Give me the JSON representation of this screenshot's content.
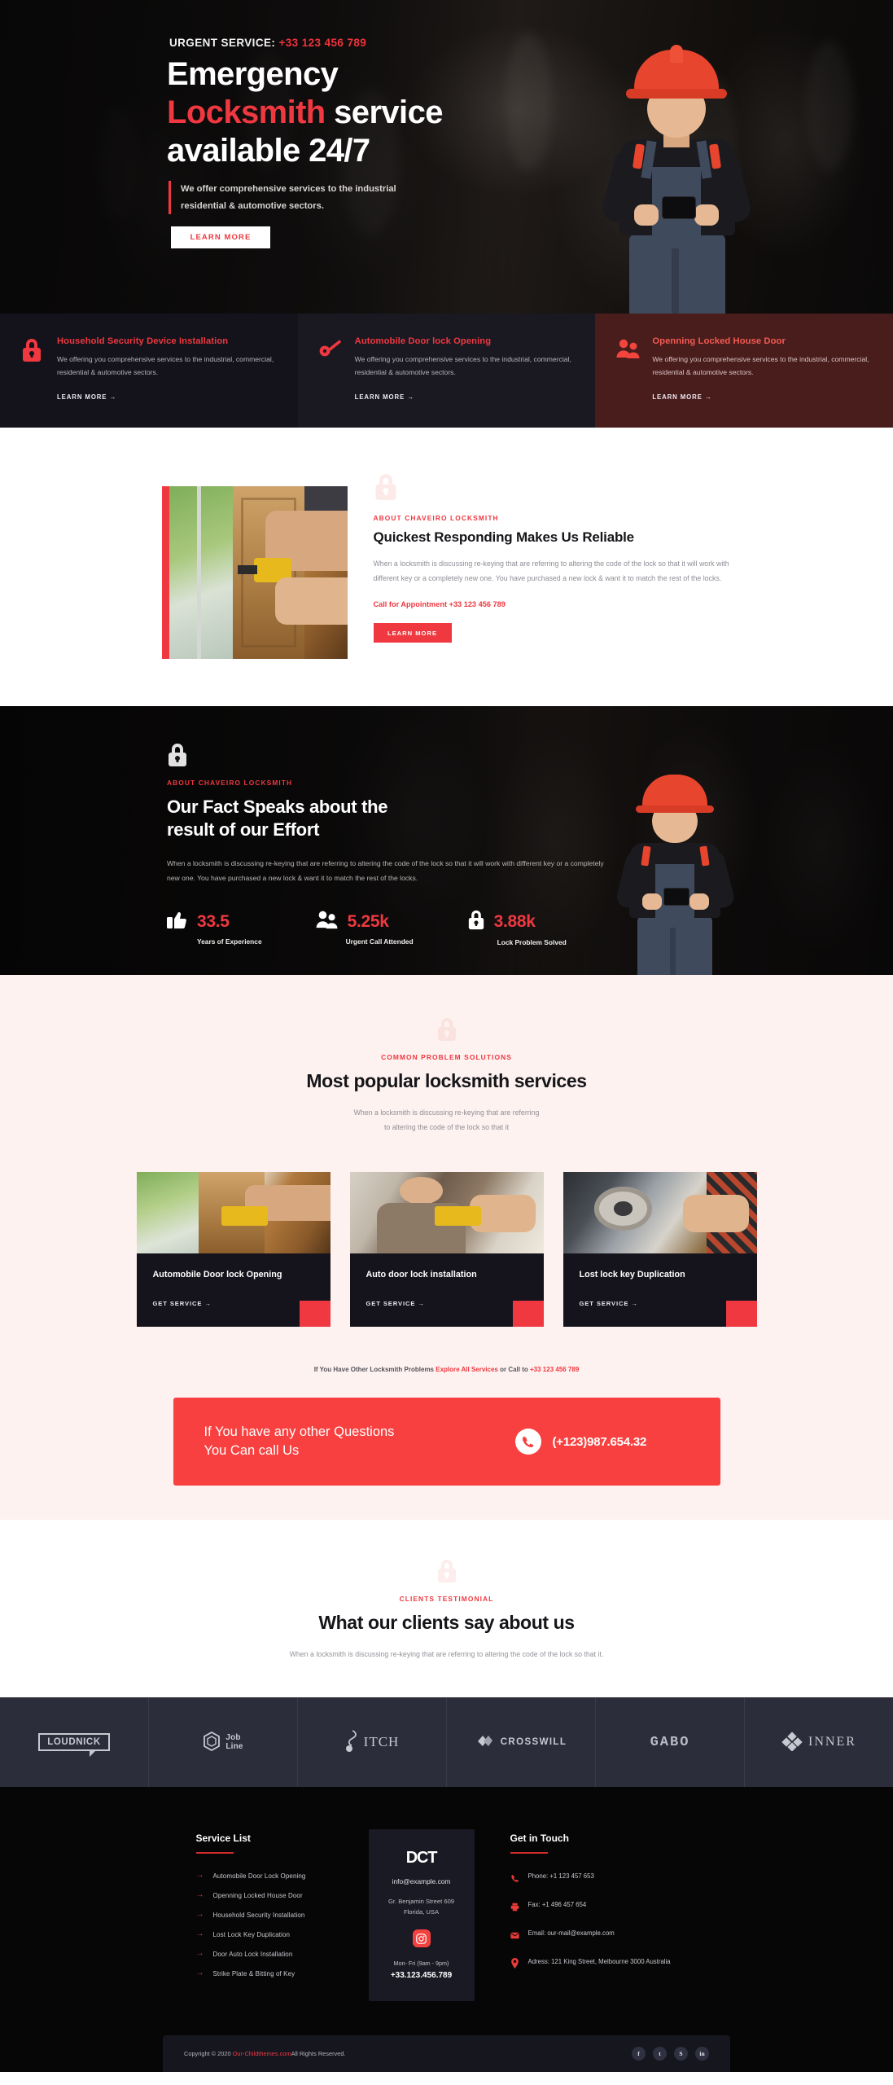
{
  "hero": {
    "urgent_label": "URGENT SERVICE:",
    "urgent_phone": "+33 123 456 789",
    "title_line1": "Emergency",
    "title_red": "Locksmith",
    "title_line2_rest": " service",
    "title_line3": "available 24/7",
    "subtitle": "We offer comprehensive services to the industrial residential & automotive sectors.",
    "button": "LEARN MORE"
  },
  "service_strip": [
    {
      "icon": "padlock-icon",
      "title": "Household Security Device Installation",
      "desc": "We offering you comprehensive services to the industrial, commercial, residential & automotive sectors.",
      "link": "LEARN MORE →"
    },
    {
      "icon": "key-icon",
      "title": "Automobile Door lock Opening",
      "desc": "We offering you comprehensive services to the industrial, commercial, residential & automotive sectors.",
      "link": "LEARN MORE →"
    },
    {
      "icon": "people-icon",
      "title": "Openning Locked House Door",
      "desc": "We offering you comprehensive services to the industrial, commercial, residential & automotive sectors.",
      "link": "LEARN MORE →"
    }
  ],
  "about": {
    "eyebrow": "ABOUT CHAVEIRO LOCKSMITH",
    "heading": "Quickest Responding Makes Us Reliable",
    "paragraph": "When a locksmith is discussing re-keying that are referring to altering the code of the lock so that it will work with different key or a completely new one. You have purchased a new lock & want it to match the rest of the locks.",
    "call_label": "Call for Appointment",
    "call_phone": "+33 123 456 789",
    "button": "LEARN MORE"
  },
  "facts": {
    "eyebrow": "ABOUT CHAVEIRO LOCKSMITH",
    "heading_line1": "Our Fact Speaks about the",
    "heading_line2": "result of our Effort",
    "paragraph": "When a locksmith is discussing re-keying that are referring to altering the code of the lock so that it will work with different key or a completely new one. You have purchased a new lock & want it to match the rest of the locks.",
    "stats": [
      {
        "icon": "thumbs-up-icon",
        "value": "33.5",
        "label": "Years of Experience"
      },
      {
        "icon": "people-icon",
        "value": "5.25k",
        "label": "Urgent Call Attended"
      },
      {
        "icon": "padlock-icon",
        "value": "3.88k",
        "label": "Lock Problem Solved"
      }
    ]
  },
  "popular": {
    "eyebrow": "COMMON PROBLEM SOLUTIONS",
    "heading": "Most popular locksmith services",
    "paragraph_line1": "When a locksmith is discussing re-keying that are referring",
    "paragraph_line2": "to altering the code of the lock so that it",
    "cards": [
      {
        "title": "Automobile Door lock Opening",
        "link": "GET SERVICE →"
      },
      {
        "title": "Auto door lock installation",
        "link": "GET SERVICE →"
      },
      {
        "title": "Lost lock key Duplication",
        "link": "GET SERVICE →"
      }
    ],
    "explore_prefix": "If You Have Other Locksmith Problems ",
    "explore_link": "Explore All Services",
    "explore_mid": " or Call to ",
    "explore_phone": "+33 123 456 789"
  },
  "cta": {
    "text_line1": "If You have any other Questions",
    "text_line2": "You Can call Us",
    "icon": "phone-icon",
    "phone": "(+123)987.654.32"
  },
  "testimonial": {
    "eyebrow": "CLIENTS TESTIMONIAL",
    "heading": "What our clients say about us",
    "paragraph": "When a locksmith is discussing re-keying that are referring to altering the code of the lock so that it."
  },
  "logos": [
    {
      "name": "LOUDNICK"
    },
    {
      "name_line1": "Job",
      "name_line2": "Line"
    },
    {
      "name": "ITCH"
    },
    {
      "name": "CROSSWILL"
    },
    {
      "name": "GABO"
    },
    {
      "name": "INNER"
    }
  ],
  "footer": {
    "services_heading": "Service List",
    "services": [
      "Automobile Door Lock Opening",
      "Openning Locked House Door",
      "Household Security Installation",
      "Lost Lock Key Duplication",
      "Door Auto Lock Installation",
      "Strike Plate & Bitting of Key"
    ],
    "card": {
      "logo": "DCT",
      "email": "info@example.com",
      "address_line1": "Gr. Benjamin Street 609",
      "address_line2": "Florida, USA",
      "social_icon": "instagram-icon",
      "hours": "Mon- Fri (9am - 9pm)",
      "phone": "+33.123.456.789"
    },
    "touch_heading": "Get in Touch",
    "touch_items": [
      {
        "icon": "phone-icon",
        "text": "Phone: +1 123 457 653"
      },
      {
        "icon": "fax-icon",
        "text": "Fax: +1 496 457 654"
      },
      {
        "icon": "envelope-icon",
        "text": "Email: our-mail@example.com"
      },
      {
        "icon": "map-pin-icon",
        "text": "Adress: 121 King Street, Melbourne 3000 Australia"
      }
    ],
    "copyright_prefix": "Copyright © 2020 ",
    "copyright_link": "Our-Childthemes.com",
    "copyright_suffix": "All Rights Reserved.",
    "socials": [
      {
        "icon": "facebook-icon",
        "glyph": "f"
      },
      {
        "icon": "twitter-icon",
        "glyph": "t"
      },
      {
        "icon": "skype-icon",
        "glyph": "S"
      },
      {
        "icon": "linkedin-icon",
        "glyph": "in"
      }
    ]
  },
  "colors": {
    "accent_red": "#ef3840",
    "cta_red": "#f7403f",
    "dark": "#15141c",
    "cream": "#fdf2f0"
  }
}
